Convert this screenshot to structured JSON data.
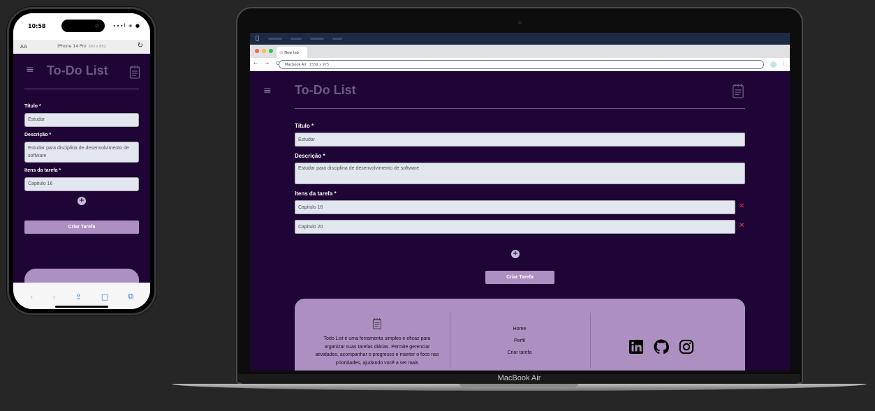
{
  "phone": {
    "status_time": "10:58",
    "status_icons": "∙∙∙l ≉ ●",
    "aa_label": "AA",
    "device_name": "iPhone 14 Pro",
    "device_size": "393 x 852",
    "reload_icon": "↻"
  },
  "laptop": {
    "device_label": "MacBook Air",
    "tab_title": "New tab",
    "omnibox_device": "Macbook Air",
    "omnibox_size": "1559 x 975",
    "nav_icons": "← → C",
    "kebab": "⋮",
    "apple_logo": ""
  },
  "app": {
    "menu_icon": "≡",
    "title": "To-Do List",
    "form": {
      "title_label": "Título *",
      "title_value": "Estudar",
      "description_label": "Descrição *",
      "description_value": "Estudar para disciplina de desenvolvimento de software",
      "items_label": "Itens da tarefa *",
      "items": [
        "Capitulo 16",
        "Capitulo 20"
      ],
      "remove_icon": "✕",
      "add_icon": "+",
      "submit_label": "Criar Tarefa"
    },
    "footer": {
      "description": "Todo List é uma ferramenta simples e eficaz para organizar suas tarefas diárias. Permite gerenciar atividades, acompanhar o progresso e manter o foco nas prioridades, ajudando você a ser mais",
      "links": [
        "Home",
        "Perfil",
        "Criar tarefa"
      ],
      "social": [
        "linkedin-icon",
        "github-icon",
        "instagram-icon"
      ]
    }
  },
  "phone_toolbar": {
    "back": "‹",
    "forward": "›",
    "share": "⇪",
    "bookmarks": "□",
    "tabs": "⧉"
  },
  "colors": {
    "app_bg": "#1e0535",
    "accent": "#ad8fc2",
    "input_bg": "#e2e6ef",
    "remove": "#e03a3a"
  }
}
